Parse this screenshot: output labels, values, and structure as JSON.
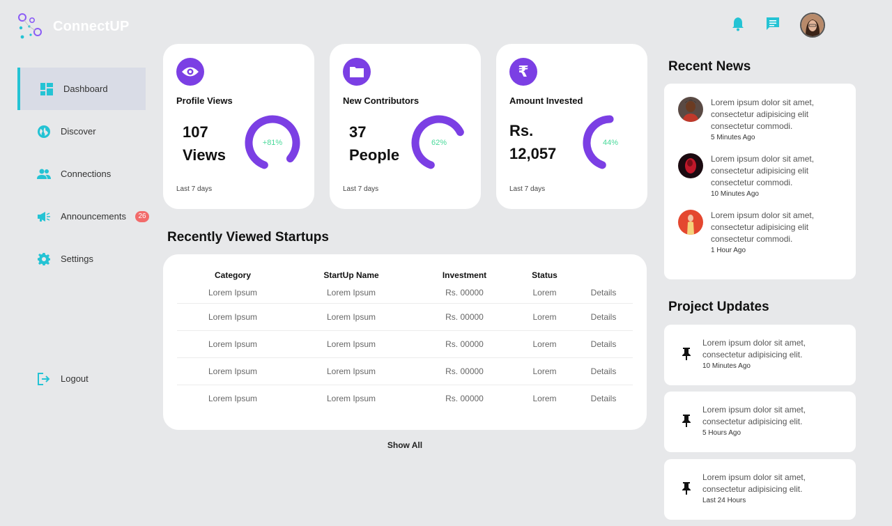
{
  "app": {
    "name": "ConnectUP"
  },
  "sidebar": {
    "items": [
      {
        "label": "Dashboard",
        "icon": "dashboard-icon",
        "active": true
      },
      {
        "label": "Discover",
        "icon": "globe-icon"
      },
      {
        "label": "Connections",
        "icon": "people-icon"
      },
      {
        "label": "Announcements",
        "icon": "megaphone-icon",
        "badge": "26"
      },
      {
        "label": "Settings",
        "icon": "gear-icon"
      }
    ],
    "logout": "Logout"
  },
  "stats": [
    {
      "label": "Profile Views",
      "value_line1": "107",
      "value_line2": "Views",
      "percent": "+81%",
      "fill": 0.81,
      "foot": "Last 7 days",
      "icon": "eye-icon"
    },
    {
      "label": "New Contributors",
      "value_line1": "37",
      "value_line2": "People",
      "percent": "62%",
      "fill": 0.62,
      "foot": "Last 7 days",
      "icon": "folder-icon"
    },
    {
      "label": "Amount Invested",
      "value_line1": "Rs.",
      "value_line2": "12,057",
      "percent": "44%",
      "fill": 0.44,
      "foot": "Last 7 days",
      "icon": "rupee-icon"
    }
  ],
  "startups": {
    "title": "Recently Viewed Startups",
    "columns": [
      "Category",
      "StartUp Name",
      "Investment",
      "Status",
      ""
    ],
    "rows": [
      [
        "Lorem Ipsum",
        "Lorem Ipsum",
        "Rs. 00000",
        "Lorem",
        "Details"
      ],
      [
        "Lorem Ipsum",
        "Lorem Ipsum",
        "Rs. 00000",
        "Lorem",
        "Details"
      ],
      [
        "Lorem Ipsum",
        "Lorem Ipsum",
        "Rs. 00000",
        "Lorem",
        "Details"
      ],
      [
        "Lorem Ipsum",
        "Lorem Ipsum",
        "Rs. 00000",
        "Lorem",
        "Details"
      ],
      [
        "Lorem Ipsum",
        "Lorem Ipsum",
        "Rs. 00000",
        "Lorem",
        "Details"
      ]
    ],
    "show_all": "Show All"
  },
  "news": {
    "title": "Recent News",
    "items": [
      {
        "text": "Lorem ipsum dolor sit amet, consectetur adipisicing elit consectetur commodi.",
        "time": "5 Minutes Ago"
      },
      {
        "text": "Lorem ipsum dolor sit amet, consectetur adipisicing elit consectetur commodi.",
        "time": "10 Minutes Ago"
      },
      {
        "text": "Lorem ipsum dolor sit amet, consectetur adipisicing elit consectetur commodi.",
        "time": "1 Hour Ago"
      }
    ]
  },
  "updates": {
    "title": "Project Updates",
    "items": [
      {
        "text": "Lorem ipsum dolor sit amet, consectetur adipisicing elit.",
        "time": "10 Minutes Ago"
      },
      {
        "text": "Lorem ipsum dolor sit amet, consectetur adipisicing elit.",
        "time": "5 Hours Ago"
      },
      {
        "text": "Lorem ipsum dolor sit amet, consectetur adipisicing elit.",
        "time": "Last 24 Hours"
      }
    ]
  },
  "colors": {
    "accent": "#7b3fe4",
    "teal": "#24c3d4",
    "green": "#49d99a",
    "badge": "#f26b6b"
  }
}
